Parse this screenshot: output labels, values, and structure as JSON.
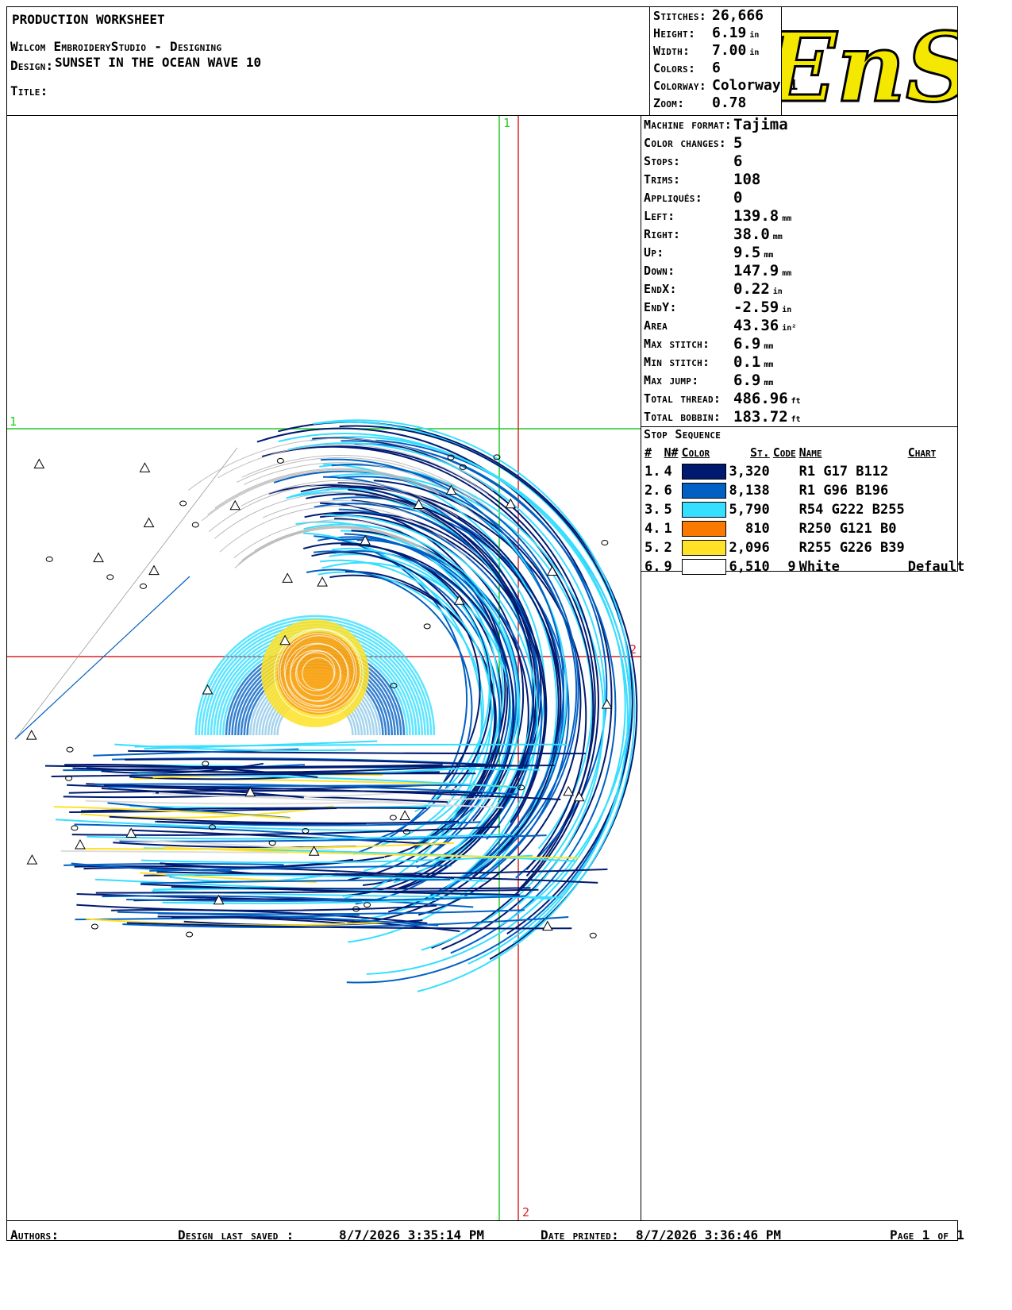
{
  "header": {
    "title": "PRODUCTION WORKSHEET",
    "software": "Wilcom EmbroideryStudio - Designing",
    "design_label": "Design:",
    "design_name": "SUNSET IN THE OCEAN WAVE  10",
    "title_label": "Title:"
  },
  "stats": [
    {
      "label": "Stitches:",
      "value": "26,666",
      "unit": ""
    },
    {
      "label": "Height:",
      "value": "6.19",
      "unit": "in"
    },
    {
      "label": "Width:",
      "value": "7.00",
      "unit": "in"
    },
    {
      "label": "Colors:",
      "value": "6",
      "unit": ""
    },
    {
      "label": "Colorway:",
      "value": "Colorway 1",
      "unit": ""
    },
    {
      "label": "Zoom:",
      "value": "0.78",
      "unit": ""
    }
  ],
  "logo": {
    "text": "EnS",
    "color": "#f5e800",
    "outline": "#000000"
  },
  "info": [
    {
      "label": "Machine format:",
      "value": "Tajima",
      "unit": ""
    },
    {
      "label": "Color changes:",
      "value": "5",
      "unit": ""
    },
    {
      "label": "Stops:",
      "value": "6",
      "unit": ""
    },
    {
      "label": "Trims:",
      "value": "108",
      "unit": ""
    },
    {
      "label": "Appliqués:",
      "value": "0",
      "unit": ""
    },
    {
      "label": "Left:",
      "value": "139.8",
      "unit": "mm"
    },
    {
      "label": "Right:",
      "value": "38.0",
      "unit": "mm"
    },
    {
      "label": "Up:",
      "value": "9.5",
      "unit": "mm"
    },
    {
      "label": "Down:",
      "value": "147.9",
      "unit": "mm"
    },
    {
      "label": "EndX:",
      "value": "0.22",
      "unit": "in"
    },
    {
      "label": "EndY:",
      "value": "-2.59",
      "unit": "in"
    },
    {
      "label": "Area",
      "value": "43.36",
      "unit": "in²"
    },
    {
      "label": "Max stitch:",
      "value": "6.9",
      "unit": "mm"
    },
    {
      "label": "Min stitch:",
      "value": "0.1",
      "unit": "mm"
    },
    {
      "label": "Max jump:",
      "value": "6.9",
      "unit": "mm"
    },
    {
      "label": "Total thread:",
      "value": "486.96",
      "unit": "ft"
    },
    {
      "label": "Total bobbin:",
      "value": "183.72",
      "unit": "ft"
    }
  ],
  "stop_sequence": {
    "title": "Stop Sequence",
    "headers": [
      "#",
      "N#",
      "Color",
      "St.",
      "Code",
      "Name",
      "Chart"
    ],
    "rows": [
      {
        "num": "1.",
        "n": "4",
        "color": "#001a70",
        "st": "3,320",
        "code": "",
        "name": "R1 G17 B112",
        "chart": ""
      },
      {
        "num": "2.",
        "n": "6",
        "color": "#0160c4",
        "st": "8,138",
        "code": "",
        "name": "R1 G96 B196",
        "chart": ""
      },
      {
        "num": "3.",
        "n": "5",
        "color": "#36deff",
        "st": "5,790",
        "code": "",
        "name": "R54 G222 B255",
        "chart": ""
      },
      {
        "num": "4.",
        "n": "1",
        "color": "#fa7900",
        "st": "810",
        "code": "",
        "name": "R250 G121 B0",
        "chart": ""
      },
      {
        "num": "5.",
        "n": "2",
        "color": "#ffe227",
        "st": "2,096",
        "code": "",
        "name": "R255 G226 B39",
        "chart": ""
      },
      {
        "num": "6.",
        "n": "9",
        "color": "#ffffff",
        "st": "6,510",
        "code": "9",
        "name": "White",
        "chart": "Default"
      }
    ]
  },
  "canvas": {
    "marker_v1": "1",
    "marker_h1": "1",
    "marker_h2": "2",
    "marker_v2": "2",
    "green": "#22cc22",
    "red": "#dd2222"
  },
  "footer": {
    "authors": "Authors:",
    "saved_label": "Design last saved :",
    "saved_value": "8/7/2026 3:35:14 PM",
    "printed_label": "Date printed:",
    "printed_value": "8/7/2026 3:36:46 PM",
    "page": "Page 1 of 1"
  }
}
